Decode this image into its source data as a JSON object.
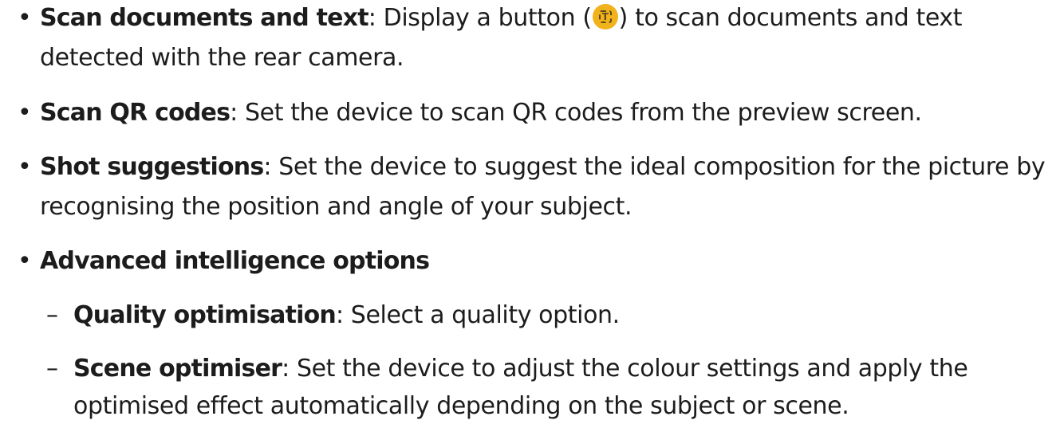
{
  "items": [
    {
      "term": "Scan documents and text",
      "line1_before_icon": ": Display a button (",
      "line1_after_icon": ") to scan documents and text",
      "line2": "detected with the rear camera."
    },
    {
      "term": "Scan QR codes",
      "line1": ": Set the device to scan QR codes from the preview screen."
    },
    {
      "term": "Shot suggestions",
      "line1": ": Set the device to suggest the ideal composition for the picture by",
      "line2": "recognising the position and angle of your subject."
    },
    {
      "term": "Advanced intelligence options"
    }
  ],
  "subitems": [
    {
      "term": "Quality optimisation",
      "line1": ": Select a quality option."
    },
    {
      "term": "Scene optimiser",
      "line1": ": Set the device to adjust the colour settings and apply the",
      "line2": "optimised effect automatically depending on the subject or scene."
    }
  ],
  "symbols": {
    "bullet": "•",
    "dash": "–",
    "scan_icon_glyph": "T"
  },
  "icons": {
    "scan_button": "scan-text-icon",
    "scan_button_color": "#f2b21c"
  }
}
